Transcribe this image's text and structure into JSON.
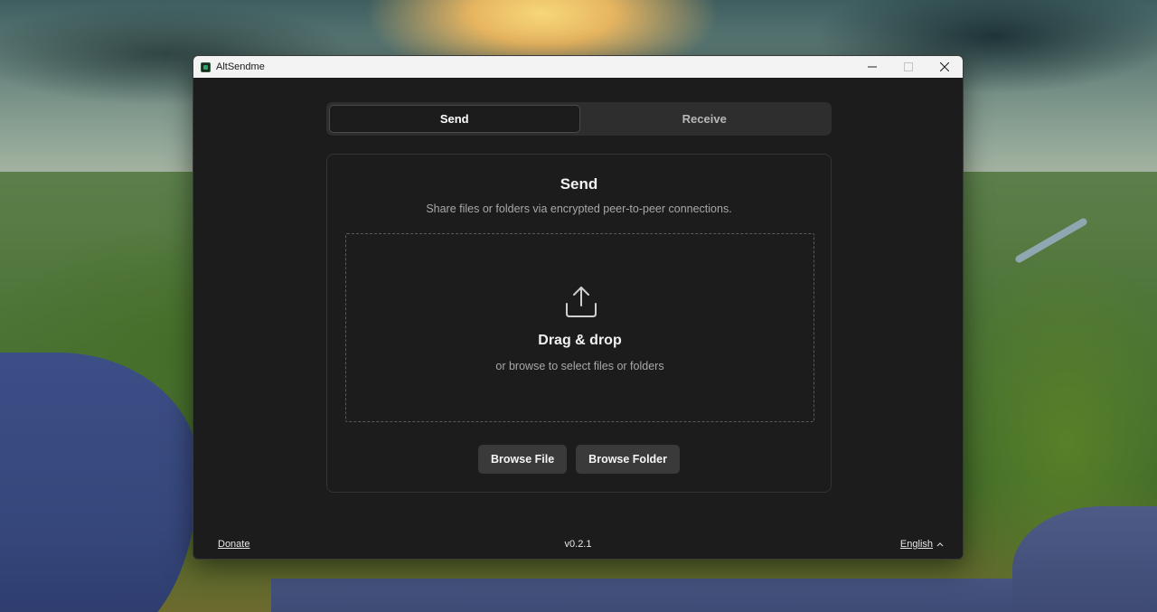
{
  "window": {
    "title": "AltSendme",
    "controls": {
      "minimize_icon": "minimize-icon",
      "maximize_icon": "maximize-icon",
      "close_icon": "close-icon"
    }
  },
  "tabs": [
    {
      "label": "Send",
      "active": true
    },
    {
      "label": "Receive",
      "active": false
    }
  ],
  "send": {
    "title": "Send",
    "subtitle": "Share files or folders via encrypted peer-to-peer connections.",
    "dropzone": {
      "icon": "upload-icon",
      "title": "Drag & drop",
      "subtitle": "or browse to select files or folders"
    },
    "buttons": {
      "browse_file": "Browse File",
      "browse_folder": "Browse Folder"
    }
  },
  "footer": {
    "donate": "Donate",
    "version": "v0.2.1",
    "language": "English",
    "language_icon": "chevron-up-icon"
  },
  "colors": {
    "window_bg": "#1c1c1c",
    "titlebar_bg": "#f3f3f3",
    "tab_bar_bg": "#2e2e2e",
    "button_bg": "#3a3a3a",
    "text_primary": "#f2f2f2",
    "text_secondary": "#a8a8a8",
    "app_accent": "#2fa36a"
  }
}
